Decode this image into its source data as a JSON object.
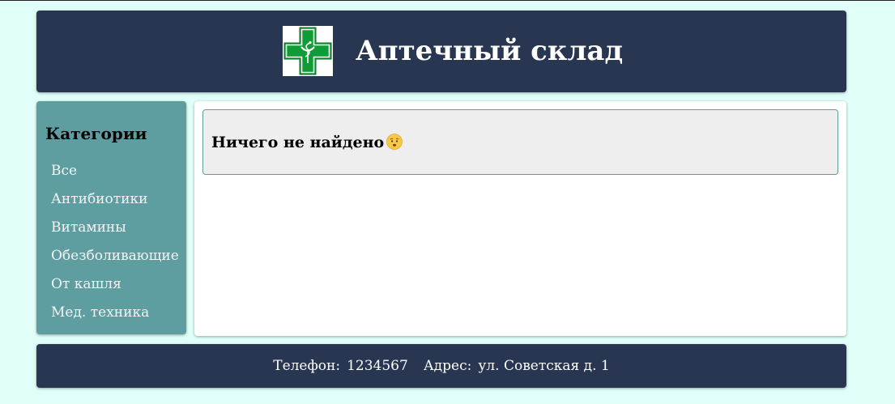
{
  "header": {
    "title": "Аптечный склад",
    "logo_icon": "pharmacy-cross-icon"
  },
  "sidebar": {
    "title": "Категории",
    "items": [
      {
        "label": "Все"
      },
      {
        "label": "Антибиотики"
      },
      {
        "label": "Витамины"
      },
      {
        "label": "Обезболивающие"
      },
      {
        "label": "От кашля"
      },
      {
        "label": "Мед. техника"
      }
    ]
  },
  "main": {
    "empty_message": "Ничего не найдено",
    "empty_icon": "worried-face-emoji"
  },
  "footer": {
    "phone_label": "Телефон:",
    "phone_value": "1234567",
    "address_label": "Адрес:",
    "address_value": "ул. Советская д. 1"
  },
  "colors": {
    "page_background": "#dffff8",
    "header_background": "#283652",
    "sidebar_background": "#5f9ea0",
    "notice_background": "#eeeeee",
    "logo_green": "#0f9b35"
  }
}
